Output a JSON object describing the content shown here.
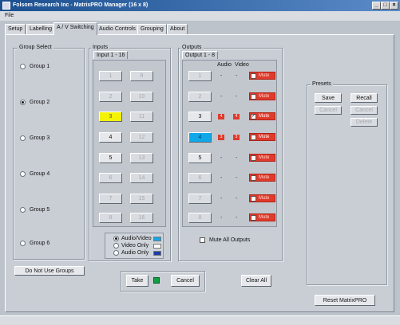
{
  "window": {
    "title": "Folsom Research Inc - MatrixPRO Manager (16 x 8)",
    "min": "_",
    "max": "□",
    "close": "×"
  },
  "menu": {
    "file": "File"
  },
  "tabs": [
    "Setup",
    "Labelling",
    "A / V Switching",
    "Audio Controls",
    "Grouping",
    "About"
  ],
  "group_select": {
    "title": "Group Select",
    "items": [
      "Group 1",
      "Group 2",
      "Group 3",
      "Group 4",
      "Group 5",
      "Group 6"
    ],
    "selected": "Group 2",
    "no_groups_button": "Do Not Use Groups"
  },
  "inputs": {
    "title": "Inputs",
    "tab": "Input 1 - 16",
    "buttons": [
      "1",
      "9",
      "2",
      "10",
      "3",
      "11",
      "4",
      "12",
      "5",
      "13",
      "6",
      "14",
      "7",
      "15",
      "8",
      "16"
    ],
    "highlighted": "3",
    "mode_options": [
      "Audio/Video",
      "Video Only",
      "Audio Only"
    ],
    "mode_selected": "Audio/Video",
    "mode_colors": [
      "#17a7e6",
      "#ffffff",
      "#1c3ea8"
    ]
  },
  "outputs": {
    "title": "Outputs",
    "tab": "Output 1 - 8",
    "col_audio": "Audio",
    "col_video": "Video",
    "rows": [
      {
        "label": "1",
        "audio": "-",
        "video": "-",
        "mute": "Mute",
        "checked": false
      },
      {
        "label": "2",
        "audio": "-",
        "video": "-",
        "mute": "Mute",
        "checked": false
      },
      {
        "label": "3",
        "audio": "4",
        "video": "4",
        "mute": "Mute",
        "checked": true
      },
      {
        "label": "4",
        "audio": "3",
        "video": "3",
        "mute": "Mute",
        "checked": false
      },
      {
        "label": "5",
        "audio": "-",
        "video": "-",
        "mute": "Mute",
        "checked": false
      },
      {
        "label": "6",
        "audio": "-",
        "video": "-",
        "mute": "Mute",
        "checked": false
      },
      {
        "label": "7",
        "audio": "-",
        "video": "-",
        "mute": "Mute",
        "checked": false
      },
      {
        "label": "8",
        "audio": "-",
        "video": "-",
        "mute": "Mute",
        "checked": false
      }
    ],
    "mute_all": "Mute All Outputs"
  },
  "actions": {
    "take": "Take",
    "cancel": "Cancel",
    "clear_all": "Clear All"
  },
  "presets": {
    "title": "Presets",
    "save": "Save",
    "recall": "Recall",
    "cancel_left": "Cancel",
    "cancel_right": "Cancel",
    "delete": "Delete"
  },
  "reset": "Reset MatrixPRO",
  "colors": {
    "accent_red": "#e03a2b",
    "selected_output": "#0fa8e8",
    "selected_input": "#f4f205",
    "take_indicator": "#12a042"
  }
}
